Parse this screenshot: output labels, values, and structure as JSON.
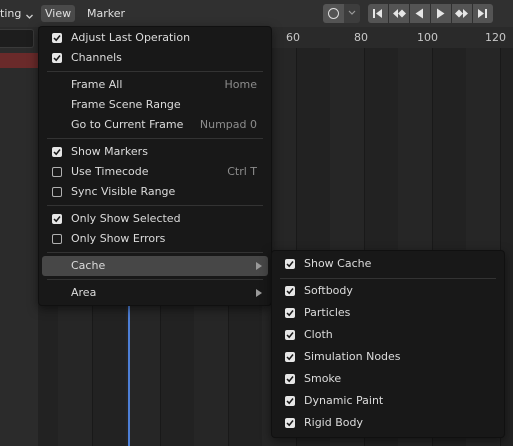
{
  "header": {
    "mode_label": "ting",
    "view_label": "View",
    "marker_label": "Marker",
    "icons": [
      "chevron-down-icon",
      "proportional-circle-icon",
      "jump-to-start-icon",
      "jump-to-prev-keyframe-icon",
      "play-reverse-icon",
      "play-icon",
      "jump-to-next-keyframe-icon",
      "jump-to-end-icon"
    ]
  },
  "ruler": {
    "ticks": [
      "60",
      "80",
      "100",
      "120"
    ]
  },
  "view_menu": {
    "items": [
      {
        "label": "Adjust Last Operation",
        "checked": true
      },
      {
        "label": "Channels",
        "checked": true
      },
      {
        "label": "Frame All",
        "shortcut": "Home"
      },
      {
        "label": "Frame Scene Range",
        "shortcut": ""
      },
      {
        "label": "Go to Current Frame",
        "shortcut": "Numpad 0"
      },
      {
        "label": "Show Markers",
        "checked": true
      },
      {
        "label": "Use Timecode",
        "checked": false,
        "shortcut": "Ctrl T"
      },
      {
        "label": "Sync Visible Range",
        "checked": false
      },
      {
        "label": "Only Show Selected",
        "checked": true
      },
      {
        "label": "Only Show Errors",
        "checked": false
      },
      {
        "label": "Cache",
        "submenu": true
      },
      {
        "label": "Area",
        "submenu": true
      }
    ]
  },
  "cache_menu": {
    "items": [
      {
        "label": "Show Cache",
        "checked": true
      },
      {
        "label": "Softbody",
        "checked": true
      },
      {
        "label": "Particles",
        "checked": true
      },
      {
        "label": "Cloth",
        "checked": true
      },
      {
        "label": "Simulation Nodes",
        "checked": true
      },
      {
        "label": "Smoke",
        "checked": true
      },
      {
        "label": "Dynamic Paint",
        "checked": true
      },
      {
        "label": "Rigid Body",
        "checked": true
      }
    ]
  },
  "colors": {
    "menu_bg": "#181818",
    "highlight": "#474747",
    "playhead": "#4d7fd6",
    "selected_channel": "#6a2a2a"
  }
}
